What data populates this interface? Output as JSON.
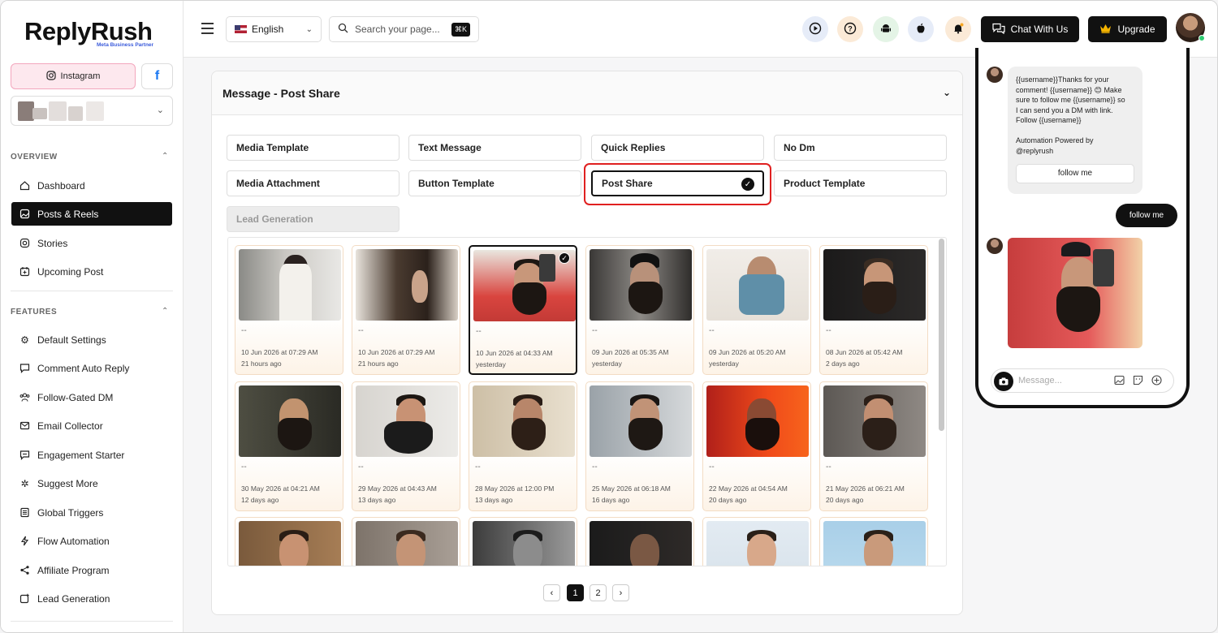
{
  "brand": {
    "name": "ReplyRush",
    "partner": "Meta Business Partner"
  },
  "accounts": {
    "instagram_label": "Instagram",
    "facebook_label": "f"
  },
  "nav": {
    "overview_title": "OVERVIEW",
    "features_title": "FEATURES",
    "overview_items": [
      {
        "label": "Dashboard",
        "icon": "home-icon"
      },
      {
        "label": "Posts & Reels",
        "icon": "image-icon",
        "active": true
      },
      {
        "label": "Stories",
        "icon": "instagram-icon"
      },
      {
        "label": "Upcoming Post",
        "icon": "calendar-icon"
      }
    ],
    "feature_items": [
      {
        "label": "Default Settings",
        "icon": "gear-icon"
      },
      {
        "label": "Comment Auto Reply",
        "icon": "comment-icon"
      },
      {
        "label": "Follow-Gated DM",
        "icon": "users-icon"
      },
      {
        "label": "Email Collector",
        "icon": "mail-icon"
      },
      {
        "label": "Engagement Starter",
        "icon": "chat-icon"
      },
      {
        "label": "Suggest More",
        "icon": "cog-icon"
      },
      {
        "label": "Global Triggers",
        "icon": "list-icon"
      },
      {
        "label": "Flow Automation",
        "icon": "bolt-icon"
      },
      {
        "label": "Affiliate Program",
        "icon": "share-icon"
      },
      {
        "label": "Lead Generation",
        "icon": "add-icon"
      }
    ]
  },
  "header": {
    "language": "English",
    "search_placeholder": "Search your page...",
    "shortcut": "⌘K",
    "chat_label": "Chat With Us",
    "upgrade_label": "Upgrade"
  },
  "panel": {
    "title": "Message - Post Share",
    "options": [
      {
        "label": "Media Template"
      },
      {
        "label": "Text Message"
      },
      {
        "label": "Quick Replies"
      },
      {
        "label": "No Dm"
      },
      {
        "label": "Media Attachment"
      },
      {
        "label": "Button Template"
      },
      {
        "label": "Post Share",
        "selected": true
      },
      {
        "label": "Product Template"
      },
      {
        "label": "Lead Generation",
        "disabled": true
      }
    ],
    "posts": [
      {
        "caption": "--",
        "date": "10 Jun 2026 at 07:29 AM",
        "ago": "21 hours ago"
      },
      {
        "caption": "--",
        "date": "10 Jun 2026 at 07:29 AM",
        "ago": "21 hours ago"
      },
      {
        "caption": "--",
        "date": "10 Jun 2026 at 04:33 AM",
        "ago": "yesterday",
        "selected": true
      },
      {
        "caption": "--",
        "date": "09 Jun 2026 at 05:35 AM",
        "ago": "yesterday"
      },
      {
        "caption": "--",
        "date": "09 Jun 2026 at 05:20 AM",
        "ago": "yesterday"
      },
      {
        "caption": "--",
        "date": "08 Jun 2026 at 05:42 AM",
        "ago": "2 days ago"
      },
      {
        "caption": "--",
        "date": "30 May 2026 at 04:21 AM",
        "ago": "12 days ago"
      },
      {
        "caption": "--",
        "date": "29 May 2026 at 04:43 AM",
        "ago": "13 days ago"
      },
      {
        "caption": "--",
        "date": "28 May 2026 at 12:00 PM",
        "ago": "13 days ago"
      },
      {
        "caption": "--",
        "date": "25 May 2026 at 06:18 AM",
        "ago": "16 days ago"
      },
      {
        "caption": "--",
        "date": "22 May 2026 at 04:54 AM",
        "ago": "20 days ago"
      },
      {
        "caption": "--",
        "date": "21 May 2026 at 06:21 AM",
        "ago": "20 days ago"
      },
      {
        "caption": "",
        "date": "",
        "ago": ""
      },
      {
        "caption": "",
        "date": "",
        "ago": ""
      },
      {
        "caption": "",
        "date": "",
        "ago": ""
      },
      {
        "caption": "",
        "date": "",
        "ago": ""
      },
      {
        "caption": "",
        "date": "",
        "ago": ""
      },
      {
        "caption": "",
        "date": "",
        "ago": ""
      }
    ],
    "pages": [
      "1",
      "2"
    ],
    "current_page": "1"
  },
  "preview": {
    "message_lines": [
      "{{username}}Thanks for your",
      "comment! {{username}} 😊 Make",
      "sure to follow me {{username}} so",
      "I can send you a DM with link.",
      "Follow {{username}}",
      "",
      "Automation Powered by",
      "@replyrush"
    ],
    "inner_button": "follow me",
    "user_reply": "follow me",
    "composer_placeholder": "Message..."
  }
}
